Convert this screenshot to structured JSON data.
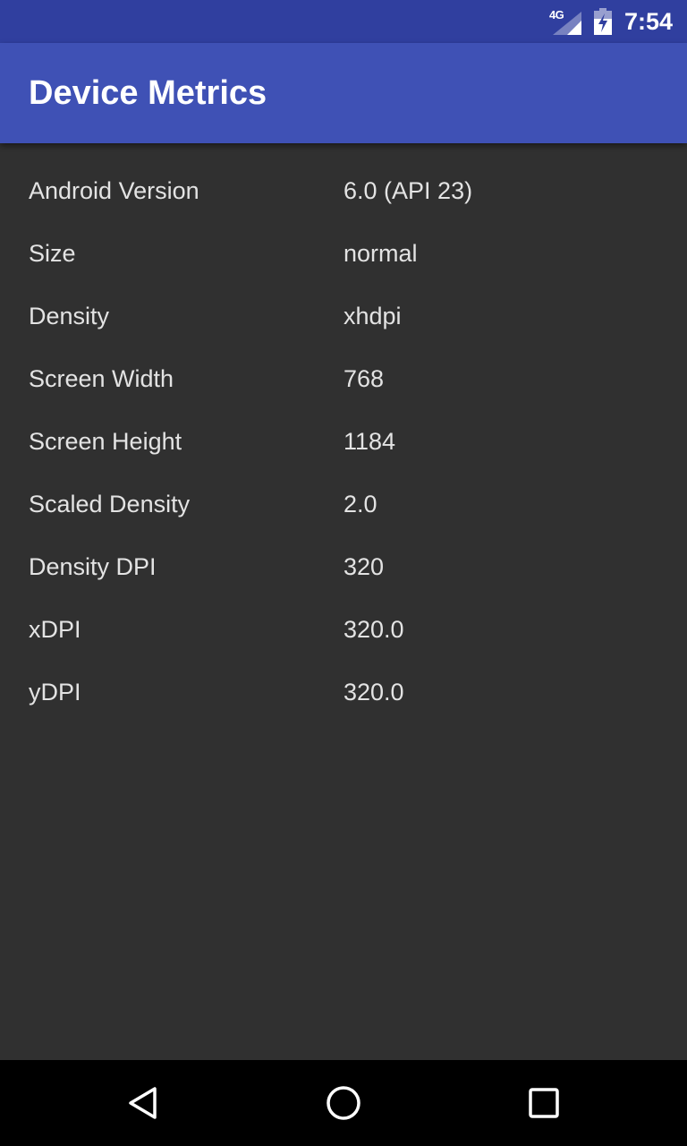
{
  "status_bar": {
    "network_type": "4G",
    "time": "7:54",
    "icons": [
      "signal-icon",
      "battery-charging-icon"
    ]
  },
  "app_bar": {
    "title": "Device Metrics"
  },
  "metrics": [
    {
      "label": "Android Version",
      "value": "6.0 (API 23)"
    },
    {
      "label": "Size",
      "value": "normal"
    },
    {
      "label": "Density",
      "value": "xhdpi"
    },
    {
      "label": "Screen Width",
      "value": "768"
    },
    {
      "label": "Screen Height",
      "value": "1184"
    },
    {
      "label": "Scaled Density",
      "value": "2.0"
    },
    {
      "label": "Density DPI",
      "value": "320"
    },
    {
      "label": "xDPI",
      "value": "320.0"
    },
    {
      "label": "yDPI",
      "value": "320.0"
    }
  ],
  "nav_bar": {
    "icons": [
      "back-icon",
      "home-icon",
      "recents-icon"
    ]
  },
  "colors": {
    "status_bar": "#303F9F",
    "app_bar": "#3F51B5",
    "background": "#303030",
    "text": "#E3E3E3",
    "nav_bar": "#000000"
  }
}
